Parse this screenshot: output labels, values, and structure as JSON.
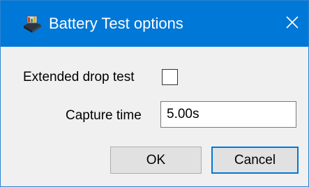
{
  "window": {
    "title": "Battery Test options",
    "icon": "battery-test-app-icon",
    "close_icon": "close-icon",
    "colors": {
      "titlebar": "#0078d7",
      "background": "#f0f0f0",
      "default_button_border": "#0078d7"
    }
  },
  "form": {
    "extended_drop_test": {
      "label": "Extended drop test",
      "checked": false
    },
    "capture_time": {
      "label": "Capture time",
      "value": "5.00s"
    }
  },
  "buttons": {
    "ok_label": "OK",
    "cancel_label": "Cancel"
  }
}
